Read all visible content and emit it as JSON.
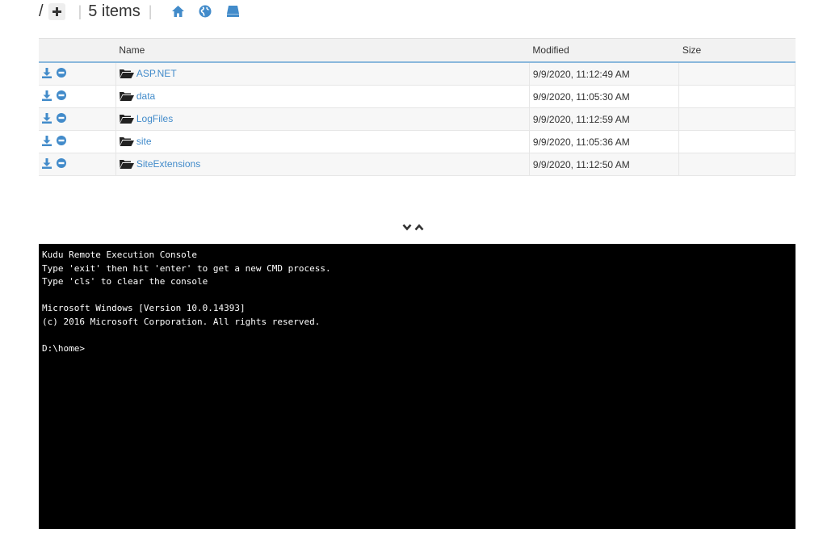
{
  "breadcrumb": {
    "root": "/",
    "add_symbol": "+",
    "separator": "|",
    "item_count": "5 items",
    "separator2": "|"
  },
  "icons": {
    "add": "plus-icon",
    "home": "home-icon",
    "globe": "globe-icon",
    "drive": "drive-icon",
    "download": "download-icon",
    "delete": "minus-circle-icon",
    "folder": "folder-open-icon",
    "collapse": "chevron-down-icon",
    "expand": "chevron-up-icon"
  },
  "colors": {
    "accent": "#428bca",
    "header_border": "#8ab8dc",
    "console_bg": "#000000",
    "console_fg": "#ffffff"
  },
  "table": {
    "headers": {
      "actions": "",
      "name": "Name",
      "modified": "Modified",
      "size": "Size"
    },
    "rows": [
      {
        "name": "ASP.NET",
        "modified": "9/9/2020, 11:12:49 AM",
        "size": ""
      },
      {
        "name": "data",
        "modified": "9/9/2020, 11:05:30 AM",
        "size": ""
      },
      {
        "name": "LogFiles",
        "modified": "9/9/2020, 11:12:59 AM",
        "size": ""
      },
      {
        "name": "site",
        "modified": "9/9/2020, 11:05:36 AM",
        "size": ""
      },
      {
        "name": "SiteExtensions",
        "modified": "9/9/2020, 11:12:50 AM",
        "size": ""
      }
    ]
  },
  "console": {
    "lines": [
      "Kudu Remote Execution Console",
      "Type 'exit' then hit 'enter' to get a new CMD process.",
      "Type 'cls' to clear the console",
      "",
      "Microsoft Windows [Version 10.0.14393]",
      "(c) 2016 Microsoft Corporation. All rights reserved.",
      "",
      "D:\\home>"
    ]
  }
}
